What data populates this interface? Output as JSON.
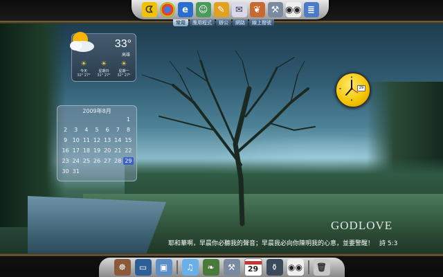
{
  "top_dock": {
    "icons": [
      "pac-icon",
      "chrome-icon",
      "ie-icon",
      "contacts-icon",
      "pencil-icon",
      "mail-icon",
      "rabbit-icon",
      "tools-icon",
      "eyes-icon",
      "stack-icon"
    ],
    "tabs": [
      "常用",
      "應用程式",
      "辦公",
      "網路",
      "線上撥號"
    ],
    "active_tab": 0
  },
  "weather": {
    "temp": "33°",
    "location": "高雄",
    "forecast": [
      {
        "day": "今天",
        "range": "32° 27°"
      },
      {
        "day": "星期日",
        "range": "31° 27°"
      },
      {
        "day": "星期一",
        "range": "32° 27°"
      }
    ]
  },
  "calendar": {
    "header": "2009年8月",
    "weeks": [
      [
        "",
        "",
        "",
        "",
        "",
        "",
        "1"
      ],
      [
        "2",
        "3",
        "4",
        "5",
        "6",
        "7",
        "8"
      ],
      [
        "9",
        "10",
        "11",
        "12",
        "13",
        "14",
        "15"
      ],
      [
        "16",
        "17",
        "18",
        "19",
        "20",
        "21",
        "22"
      ],
      [
        "23",
        "24",
        "25",
        "26",
        "27",
        "28",
        "29"
      ],
      [
        "30",
        "31",
        "",
        "",
        "",
        "",
        ""
      ]
    ],
    "today": "29"
  },
  "clock": {
    "date": "29"
  },
  "wallpaper": {
    "watermark": "GODLOVE",
    "verse": "耶和華啊，早晨你必聽我的聲音；早晨我必向你陳明我的心意，並要警醒！",
    "verse_ref": "詩 5:3"
  },
  "bottom_dock": {
    "icons": [
      "finder-icon",
      "desktop-icon",
      "display-icon",
      "itunes-icon",
      "bird-icon",
      "tools-icon",
      "calendar-icon",
      "jar-icon",
      "eyes-icon",
      "trash-icon"
    ],
    "calendar_day": "29"
  },
  "colors": {
    "accent": "#f4c400",
    "dock_gold": "#7a6a40",
    "today_highlight": "#3c5fc8"
  }
}
